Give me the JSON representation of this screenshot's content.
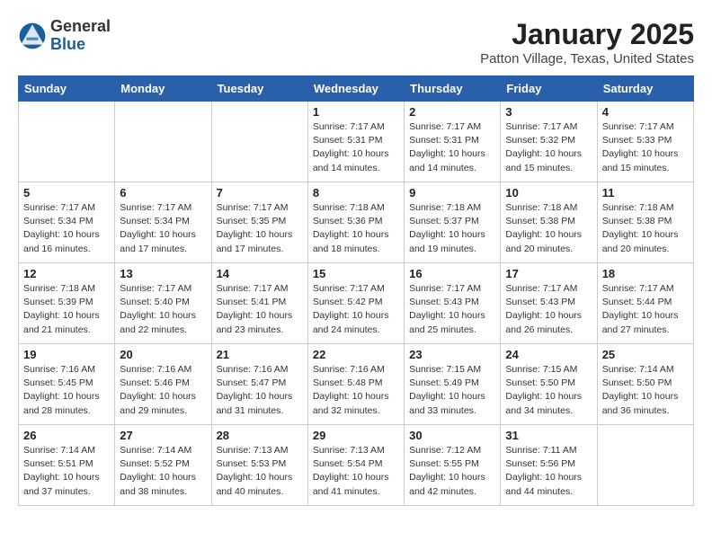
{
  "header": {
    "logo": {
      "general": "General",
      "blue": "Blue"
    },
    "title": "January 2025",
    "location": "Patton Village, Texas, United States"
  },
  "weekdays": [
    "Sunday",
    "Monday",
    "Tuesday",
    "Wednesday",
    "Thursday",
    "Friday",
    "Saturday"
  ],
  "weeks": [
    [
      {
        "day": "",
        "info": ""
      },
      {
        "day": "",
        "info": ""
      },
      {
        "day": "",
        "info": ""
      },
      {
        "day": "1",
        "info": "Sunrise: 7:17 AM\nSunset: 5:31 PM\nDaylight: 10 hours\nand 14 minutes."
      },
      {
        "day": "2",
        "info": "Sunrise: 7:17 AM\nSunset: 5:31 PM\nDaylight: 10 hours\nand 14 minutes."
      },
      {
        "day": "3",
        "info": "Sunrise: 7:17 AM\nSunset: 5:32 PM\nDaylight: 10 hours\nand 15 minutes."
      },
      {
        "day": "4",
        "info": "Sunrise: 7:17 AM\nSunset: 5:33 PM\nDaylight: 10 hours\nand 15 minutes."
      }
    ],
    [
      {
        "day": "5",
        "info": "Sunrise: 7:17 AM\nSunset: 5:34 PM\nDaylight: 10 hours\nand 16 minutes."
      },
      {
        "day": "6",
        "info": "Sunrise: 7:17 AM\nSunset: 5:34 PM\nDaylight: 10 hours\nand 17 minutes."
      },
      {
        "day": "7",
        "info": "Sunrise: 7:17 AM\nSunset: 5:35 PM\nDaylight: 10 hours\nand 17 minutes."
      },
      {
        "day": "8",
        "info": "Sunrise: 7:18 AM\nSunset: 5:36 PM\nDaylight: 10 hours\nand 18 minutes."
      },
      {
        "day": "9",
        "info": "Sunrise: 7:18 AM\nSunset: 5:37 PM\nDaylight: 10 hours\nand 19 minutes."
      },
      {
        "day": "10",
        "info": "Sunrise: 7:18 AM\nSunset: 5:38 PM\nDaylight: 10 hours\nand 20 minutes."
      },
      {
        "day": "11",
        "info": "Sunrise: 7:18 AM\nSunset: 5:38 PM\nDaylight: 10 hours\nand 20 minutes."
      }
    ],
    [
      {
        "day": "12",
        "info": "Sunrise: 7:18 AM\nSunset: 5:39 PM\nDaylight: 10 hours\nand 21 minutes."
      },
      {
        "day": "13",
        "info": "Sunrise: 7:17 AM\nSunset: 5:40 PM\nDaylight: 10 hours\nand 22 minutes."
      },
      {
        "day": "14",
        "info": "Sunrise: 7:17 AM\nSunset: 5:41 PM\nDaylight: 10 hours\nand 23 minutes."
      },
      {
        "day": "15",
        "info": "Sunrise: 7:17 AM\nSunset: 5:42 PM\nDaylight: 10 hours\nand 24 minutes."
      },
      {
        "day": "16",
        "info": "Sunrise: 7:17 AM\nSunset: 5:43 PM\nDaylight: 10 hours\nand 25 minutes."
      },
      {
        "day": "17",
        "info": "Sunrise: 7:17 AM\nSunset: 5:43 PM\nDaylight: 10 hours\nand 26 minutes."
      },
      {
        "day": "18",
        "info": "Sunrise: 7:17 AM\nSunset: 5:44 PM\nDaylight: 10 hours\nand 27 minutes."
      }
    ],
    [
      {
        "day": "19",
        "info": "Sunrise: 7:16 AM\nSunset: 5:45 PM\nDaylight: 10 hours\nand 28 minutes."
      },
      {
        "day": "20",
        "info": "Sunrise: 7:16 AM\nSunset: 5:46 PM\nDaylight: 10 hours\nand 29 minutes."
      },
      {
        "day": "21",
        "info": "Sunrise: 7:16 AM\nSunset: 5:47 PM\nDaylight: 10 hours\nand 31 minutes."
      },
      {
        "day": "22",
        "info": "Sunrise: 7:16 AM\nSunset: 5:48 PM\nDaylight: 10 hours\nand 32 minutes."
      },
      {
        "day": "23",
        "info": "Sunrise: 7:15 AM\nSunset: 5:49 PM\nDaylight: 10 hours\nand 33 minutes."
      },
      {
        "day": "24",
        "info": "Sunrise: 7:15 AM\nSunset: 5:50 PM\nDaylight: 10 hours\nand 34 minutes."
      },
      {
        "day": "25",
        "info": "Sunrise: 7:14 AM\nSunset: 5:50 PM\nDaylight: 10 hours\nand 36 minutes."
      }
    ],
    [
      {
        "day": "26",
        "info": "Sunrise: 7:14 AM\nSunset: 5:51 PM\nDaylight: 10 hours\nand 37 minutes."
      },
      {
        "day": "27",
        "info": "Sunrise: 7:14 AM\nSunset: 5:52 PM\nDaylight: 10 hours\nand 38 minutes."
      },
      {
        "day": "28",
        "info": "Sunrise: 7:13 AM\nSunset: 5:53 PM\nDaylight: 10 hours\nand 40 minutes."
      },
      {
        "day": "29",
        "info": "Sunrise: 7:13 AM\nSunset: 5:54 PM\nDaylight: 10 hours\nand 41 minutes."
      },
      {
        "day": "30",
        "info": "Sunrise: 7:12 AM\nSunset: 5:55 PM\nDaylight: 10 hours\nand 42 minutes."
      },
      {
        "day": "31",
        "info": "Sunrise: 7:11 AM\nSunset: 5:56 PM\nDaylight: 10 hours\nand 44 minutes."
      },
      {
        "day": "",
        "info": ""
      }
    ]
  ]
}
